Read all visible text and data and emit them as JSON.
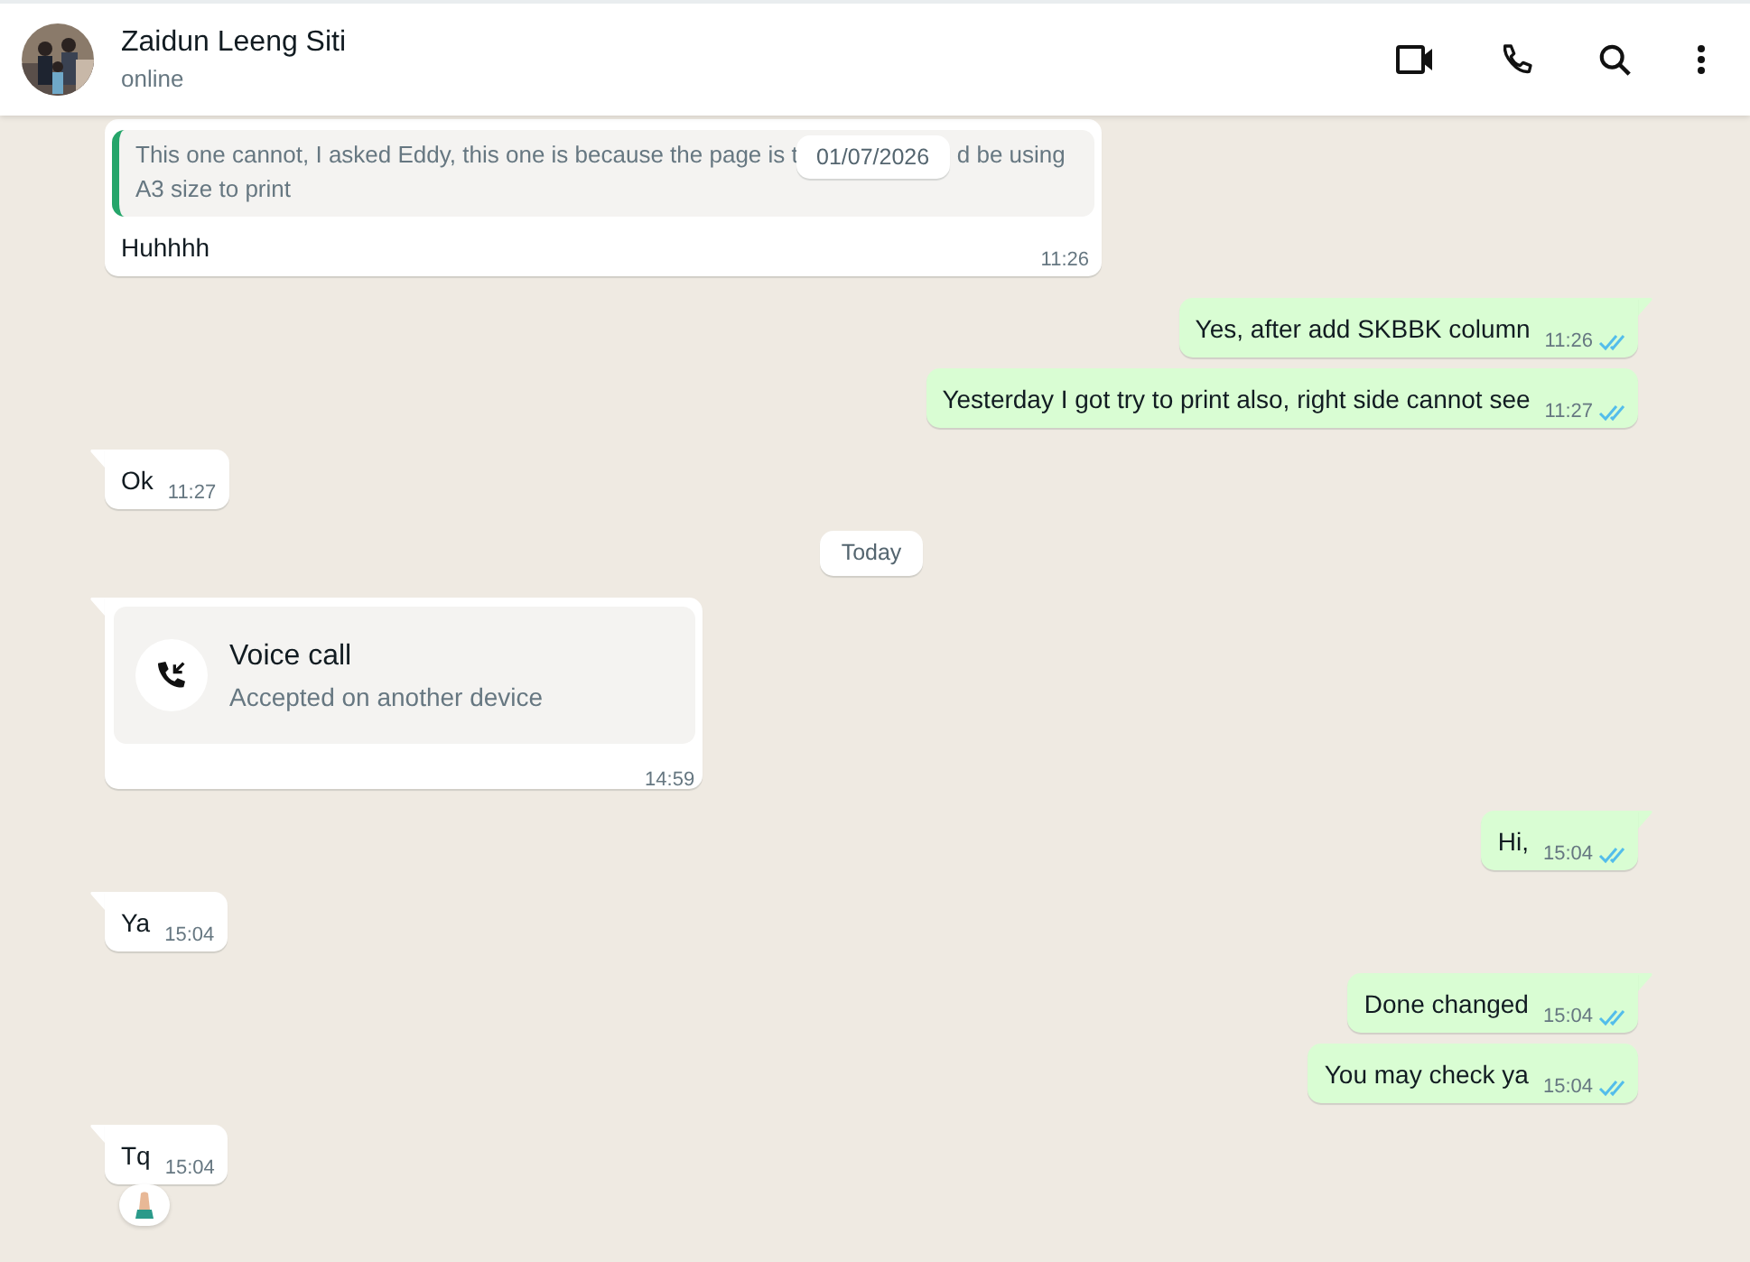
{
  "header": {
    "name": "Zaidun Leeng Siti",
    "status": "online"
  },
  "sticky_date": "01/07/2026",
  "messages": [
    {
      "kind": "quote",
      "outgoing": false,
      "tail": false,
      "quote_before": "This one cannot, I asked Eddy, this one is because the page is t",
      "quote_after": "d be using",
      "quote_line2": "A3 size to print",
      "text": "Huhhhh",
      "time": "11:26"
    },
    {
      "kind": "text",
      "outgoing": true,
      "tail": true,
      "text": "Yes, after add SKBBK column",
      "time": "11:26",
      "read": true
    },
    {
      "kind": "text",
      "outgoing": true,
      "tail": false,
      "text": "Yesterday I got try to print also, right side cannot see",
      "time": "11:27",
      "read": true
    },
    {
      "kind": "text",
      "outgoing": false,
      "tail": true,
      "text": "Ok",
      "time": "11:27"
    },
    {
      "kind": "date",
      "text": "Today"
    },
    {
      "kind": "call",
      "outgoing": false,
      "tail": true,
      "title": "Voice call",
      "subtitle": "Accepted on another device",
      "time": "14:59"
    },
    {
      "kind": "text",
      "outgoing": true,
      "tail": true,
      "text": "Hi,",
      "time": "15:04",
      "read": true
    },
    {
      "kind": "text",
      "outgoing": false,
      "tail": true,
      "text": "Ya",
      "time": "15:04"
    },
    {
      "kind": "text",
      "outgoing": true,
      "tail": true,
      "text": "Done changed",
      "time": "15:04",
      "read": true
    },
    {
      "kind": "text",
      "outgoing": true,
      "tail": false,
      "text": "You may check ya",
      "time": "15:04",
      "read": true
    },
    {
      "kind": "text",
      "outgoing": false,
      "tail": true,
      "text": "Tq",
      "time": "15:04",
      "reaction": {
        "kind": "praying-hands"
      }
    }
  ]
}
